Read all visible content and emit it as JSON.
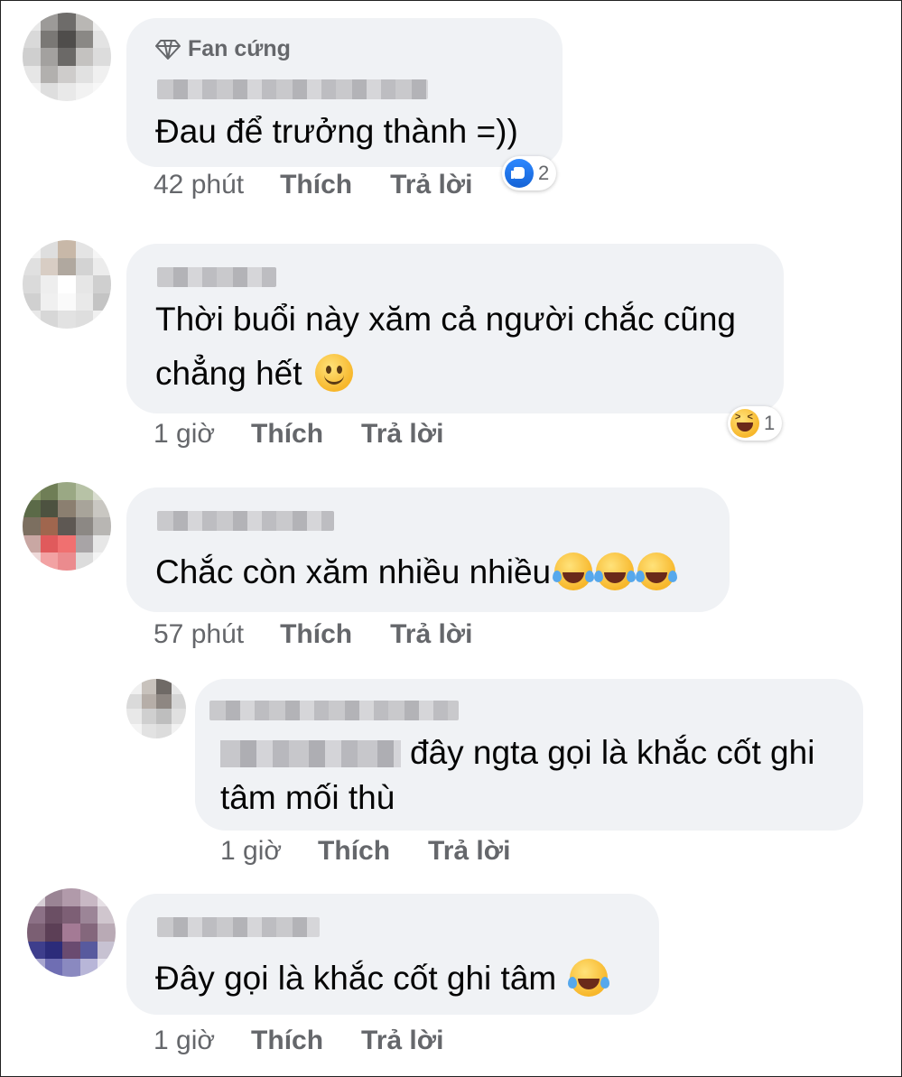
{
  "comments": [
    {
      "badge": "Fan cứng",
      "text": "Đau để trưởng thành =))",
      "time": "42 phút",
      "like_label": "Thích",
      "reply_label": "Trả lời",
      "reaction": {
        "icon": "like-icon",
        "count": "2"
      }
    },
    {
      "text_line1": "Thời buổi này xăm cả người chắc cũng",
      "text_line2": "chẳng hết",
      "time": "1 giờ",
      "like_label": "Thích",
      "reply_label": "Trả lời",
      "reaction": {
        "icon": "haha-icon",
        "count": "1"
      }
    },
    {
      "text": "Chắc còn xăm nhiều nhiều",
      "time": "57 phút",
      "like_label": "Thích",
      "reply_label": "Trả lời"
    },
    {
      "text_line1": "đây ngta gọi là khắc cốt ghi",
      "text_line2": "tâm mối thù",
      "time": "1 giờ",
      "like_label": "Thích",
      "reply_label": "Trả lời"
    },
    {
      "text": "Đây gọi là khắc cốt ghi tâm",
      "time": "1 giờ",
      "like_label": "Thích",
      "reply_label": "Trả lời"
    }
  ],
  "colors": {
    "bubble": "#f0f2f5",
    "meta": "#65676b",
    "like_blue": "#1877f2"
  }
}
